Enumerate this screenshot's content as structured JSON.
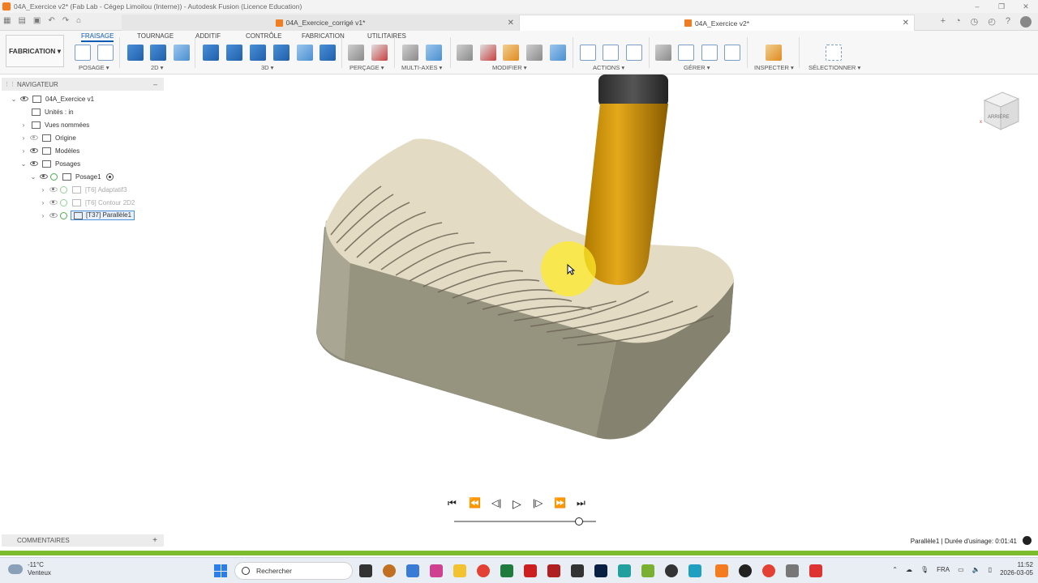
{
  "window": {
    "title": "04A_Exercice v2* (Fab Lab - Cégep Limoilou (Interne)) - Autodesk Fusion (Licence Education)"
  },
  "tabs": [
    {
      "label": "04A_Exercice_corrigé v1*",
      "active": false
    },
    {
      "label": "04A_Exercice v2*",
      "active": true
    }
  ],
  "ribbon": {
    "workspace": "FABRICATION",
    "tabs": [
      "FRAISAGE",
      "TOURNAGE",
      "ADDITIF",
      "CONTRÔLE",
      "FABRICATION",
      "UTILITAIRES"
    ],
    "active_tab": "FRAISAGE",
    "groups": [
      "POSAGE",
      "2D",
      "3D",
      "PERÇAGE",
      "MULTI-AXES",
      "MODIFIER",
      "ACTIONS",
      "GÉRER",
      "INSPECTER",
      "SÉLECTIONNER"
    ],
    "accent": "#0d5bb5"
  },
  "navigator": {
    "title": "NAVIGATEUR",
    "root": "04A_Exercice v1",
    "units": "Unités : in",
    "named_views": "Vues nommées",
    "origin": "Origine",
    "models": "Modèles",
    "setups": "Posages",
    "setup1": "Posage1",
    "ops": [
      "[T6] Adaptatif3",
      "[T6] Contour 2D2",
      "[T37] Parallèle1"
    ]
  },
  "viewcube": {
    "face": "ARRIÈRE"
  },
  "playback": {
    "controls": [
      "skip-start",
      "prev-op",
      "step-back",
      "play",
      "step-forward",
      "next-op",
      "skip-end"
    ],
    "progress": 0.88
  },
  "comments": {
    "title": "COMMENTAIRES"
  },
  "status": {
    "text": "Parallèle1 | Durée d'usinage: 0:01:41"
  },
  "taskbar": {
    "weather_temp": "-11°C",
    "weather_desc": "Venteux",
    "search_placeholder": "Rechercher",
    "lang": "FRA",
    "time": "11:52",
    "date": "2026-03-05"
  }
}
